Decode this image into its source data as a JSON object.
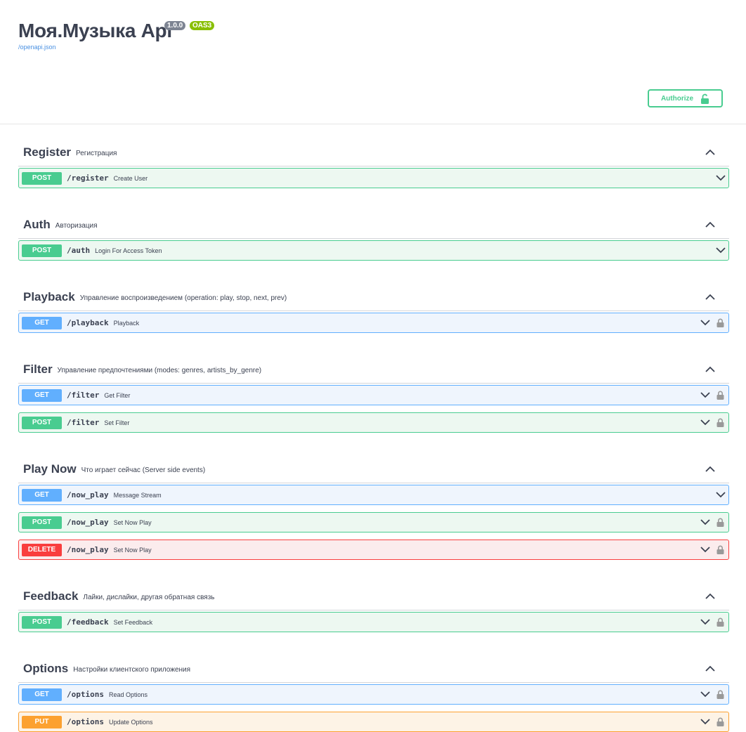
{
  "header": {
    "title": "Моя.Музыка Api",
    "version": "1.0.0",
    "oas": "OAS3",
    "spec_link": "/openapi.json",
    "authorize_label": "Authorize"
  },
  "sections": [
    {
      "name": "Register",
      "description": "Регистрация",
      "operations": [
        {
          "method": "POST",
          "path": "/register",
          "summary": "Create User",
          "locked": false
        }
      ]
    },
    {
      "name": "Auth",
      "description": "Авторизация",
      "operations": [
        {
          "method": "POST",
          "path": "/auth",
          "summary": "Login For Access Token",
          "locked": false
        }
      ]
    },
    {
      "name": "Playback",
      "description": "Управление воспроизведением (operation: play, stop, next, prev)",
      "operations": [
        {
          "method": "GET",
          "path": "/playback",
          "summary": "Playback",
          "locked": true
        }
      ]
    },
    {
      "name": "Filter",
      "description": "Управление предпочтениями (modes: genres, artists_by_genre)",
      "operations": [
        {
          "method": "GET",
          "path": "/filter",
          "summary": "Get Filter",
          "locked": true
        },
        {
          "method": "POST",
          "path": "/filter",
          "summary": "Set Filter",
          "locked": true
        }
      ]
    },
    {
      "name": "Play Now",
      "description": "Что играет сейчас (Server side events)",
      "operations": [
        {
          "method": "GET",
          "path": "/now_play",
          "summary": "Message Stream",
          "locked": false
        },
        {
          "method": "POST",
          "path": "/now_play",
          "summary": "Set Now Play",
          "locked": true
        },
        {
          "method": "DELETE",
          "path": "/now_play",
          "summary": "Set Now Play",
          "locked": true
        }
      ]
    },
    {
      "name": "Feedback",
      "description": "Лайки, дислайки, другая обратная связь",
      "operations": [
        {
          "method": "POST",
          "path": "/feedback",
          "summary": "Set Feedback",
          "locked": true
        }
      ]
    },
    {
      "name": "Options",
      "description": "Настройки клиентского приложения",
      "operations": [
        {
          "method": "GET",
          "path": "/options",
          "summary": "Read Options",
          "locked": true
        },
        {
          "method": "PUT",
          "path": "/options",
          "summary": "Update Options",
          "locked": true
        }
      ]
    }
  ],
  "colors": {
    "post": "#49cc90",
    "get": "#61affe",
    "delete": "#f93e3e",
    "put": "#fca130"
  }
}
